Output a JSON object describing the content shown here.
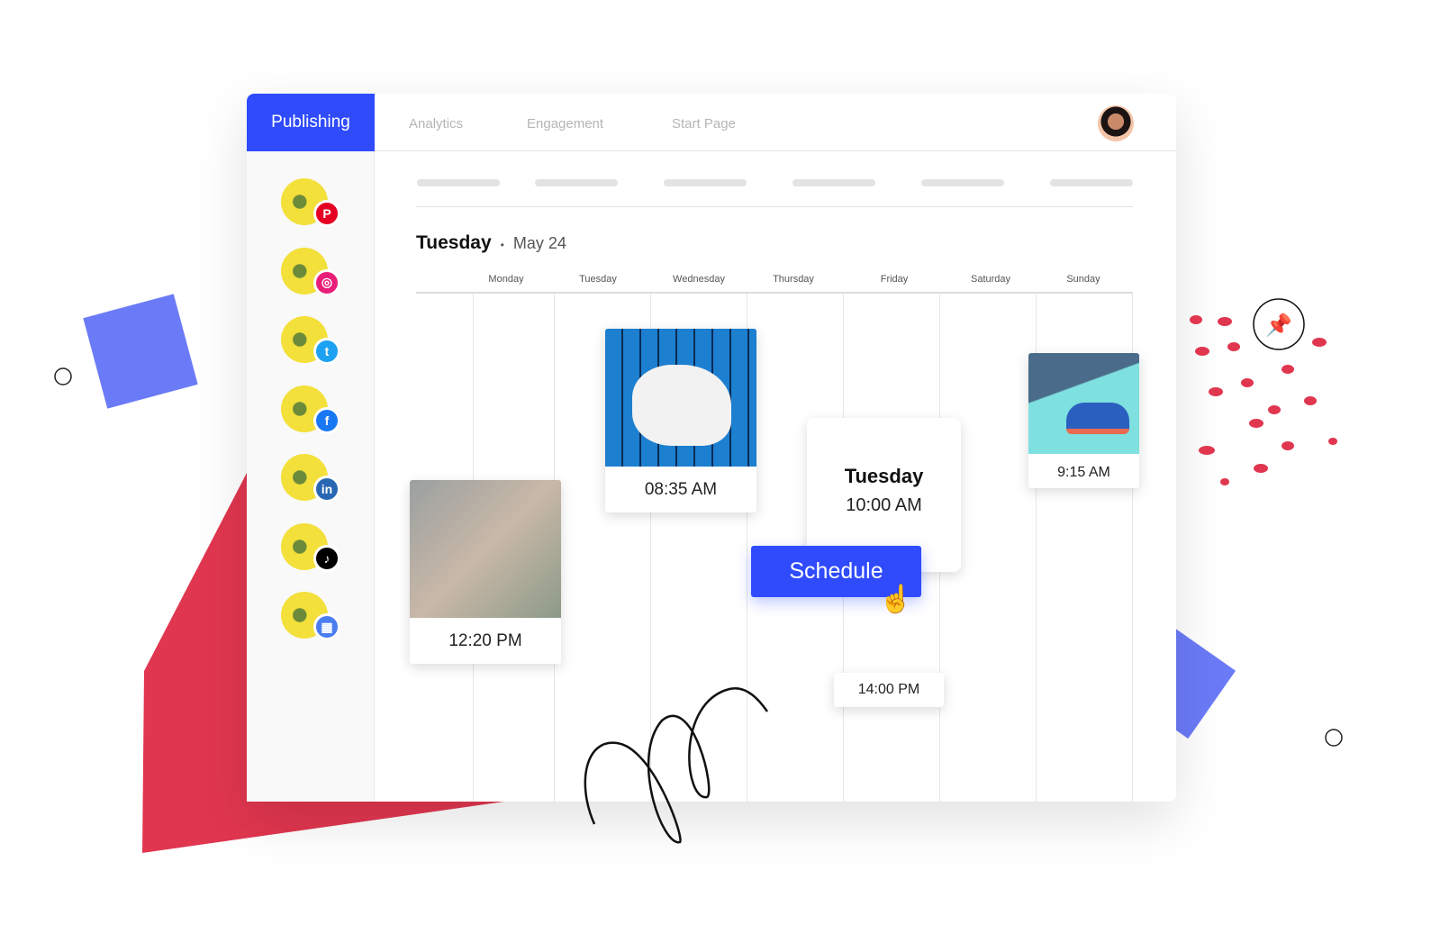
{
  "nav": {
    "active": "Publishing",
    "tabs": [
      "Analytics",
      "Engagement",
      "Start Page"
    ]
  },
  "accounts": [
    {
      "network": "pinterest-icon",
      "color": "#e60023",
      "glyph": "P"
    },
    {
      "network": "instagram-icon",
      "color": "#e91e78",
      "glyph": "◎"
    },
    {
      "network": "twitter-icon",
      "color": "#1da1f2",
      "glyph": "t"
    },
    {
      "network": "facebook-icon",
      "color": "#1877f2",
      "glyph": "f"
    },
    {
      "network": "linkedin-icon",
      "color": "#2867b2",
      "glyph": "in"
    },
    {
      "network": "tiktok-icon",
      "color": "#000000",
      "glyph": "♪"
    },
    {
      "network": "google-business-icon",
      "color": "#4a7ef0",
      "glyph": "▦"
    }
  ],
  "date": {
    "weekday": "Tuesday",
    "separator": "•",
    "date": "May 24"
  },
  "days": [
    "Monday",
    "Tuesday",
    "Wednesday",
    "Thursday",
    "Friday",
    "Saturday",
    "Sunday"
  ],
  "posts": [
    {
      "time": "12:20 PM"
    },
    {
      "time": "08:35 AM"
    },
    {
      "time": "9:15 AM"
    }
  ],
  "popup": {
    "day": "Tuesday",
    "time": "10:00 AM",
    "button": "Schedule"
  },
  "slot": {
    "time": "14:00 PM"
  },
  "colors": {
    "accent": "#2f4bfc",
    "red": "#e0364f",
    "blue_shape": "#6b7bf7"
  }
}
